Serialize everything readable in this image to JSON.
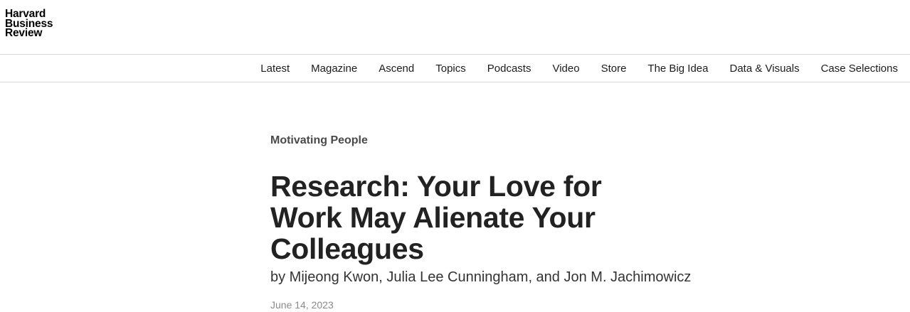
{
  "logo": {
    "line1": "Harvard",
    "line2": "Business",
    "line3": "Review"
  },
  "nav": {
    "items": [
      {
        "label": "Latest"
      },
      {
        "label": "Magazine"
      },
      {
        "label": "Ascend"
      },
      {
        "label": "Topics"
      },
      {
        "label": "Podcasts"
      },
      {
        "label": "Video"
      },
      {
        "label": "Store"
      },
      {
        "label": "The Big Idea"
      },
      {
        "label": "Data & Visuals"
      },
      {
        "label": "Case Selections"
      }
    ]
  },
  "article": {
    "topic": "Motivating People",
    "headline": "Research: Your Love for Work May Alienate Your Colleagues",
    "byline": "by Mijeong Kwon, Julia Lee Cunningham, and Jon M. Jachimowicz",
    "date": "June 14, 2023"
  },
  "colors": {
    "text": "#222222",
    "topic": "#4a4a4a",
    "date": "#8a8a8a",
    "divider": "#d9d9d9"
  }
}
